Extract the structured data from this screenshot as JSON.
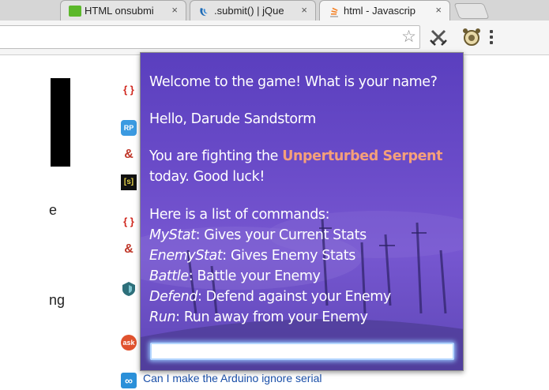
{
  "tabs": [
    {
      "title": "HTML onsubmi",
      "close": "×",
      "favicon_color": "#5cb82b"
    },
    {
      "title": ".submit() | jQue",
      "close": "×",
      "favicon_color": "#1f6bb5"
    },
    {
      "title": "html - Javascrip",
      "close": "×",
      "favicon_color": "#f48024"
    }
  ],
  "toolbar": {
    "star": "☆"
  },
  "page": {
    "fragments": [
      "e",
      "ng"
    ],
    "side_icons": [
      "{ }",
      "RP",
      "&",
      "[s]",
      "{ }",
      "&",
      "",
      "ask",
      "∞"
    ],
    "question_link": "Can I make the Arduino ignore serial",
    "question_sub": "..."
  },
  "game": {
    "welcome": "Welcome to the game! What is your name?",
    "greeting": "Hello, Darude Sandstorm",
    "fight_prefix": "You are fighting the ",
    "enemy": "Unperturbed Serpent",
    "fight_suffix": "today. Good luck!",
    "commands_header": "Here is a list of commands:",
    "commands": [
      {
        "name": "MyStat",
        "desc": ": Gives your Current Stats"
      },
      {
        "name": "EnemyStat",
        "desc": ": Gives Enemy Stats"
      },
      {
        "name": "Battle",
        "desc": ": Battle your Enemy"
      },
      {
        "name": "Defend",
        "desc": ": Defend against your Enemy"
      },
      {
        "name": "Run",
        "desc": ": Run away from your Enemy"
      }
    ],
    "input_value": "",
    "input_placeholder": ""
  }
}
